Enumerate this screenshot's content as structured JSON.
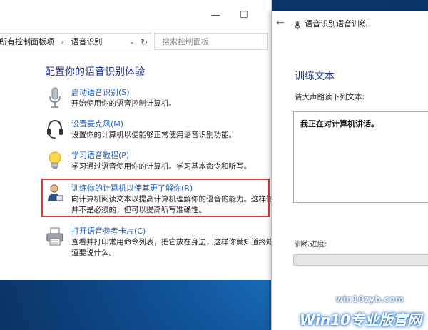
{
  "control_panel": {
    "breadcrumb": [
      "所有控制面板项",
      "语音识别"
    ],
    "search_placeholder": "搜索控制面板",
    "heading": "配置你的语音识别体验",
    "items": [
      {
        "title": "启动语音识别(S)",
        "desc": [
          "开始使用你的语音控制计算机。"
        ],
        "icon": "microphone-icon"
      },
      {
        "title": "设置麦克风(M)",
        "desc": [
          "设置你的计算机以便能够正常使用语音识别功能。"
        ],
        "icon": "headset-icon"
      },
      {
        "title": "学习语音教程(P)",
        "desc": [
          "学习通过语音使用你的计算机。学习基本命令和听写。"
        ],
        "icon": "lightbulb-icon"
      },
      {
        "title": "训练你的计算机以使其更了解你(R)",
        "desc": [
          "向计算机阅读文本以提高计算机理解你的语音的能力。这样做",
          "并不是必须的，但可以提高听写准确性。"
        ],
        "icon": "user-training-icon"
      },
      {
        "title": "打开语音参考卡片(C)",
        "desc": [
          "查看并打印常用命令列表，把它放在身边，这样你就知道终知",
          "道要说什么。"
        ],
        "icon": "printer-icon"
      }
    ]
  },
  "wizard": {
    "title": "语音识别语音训练",
    "heading": "训练文本",
    "prompt": "请大声朗读下列文本:",
    "read_text": "我正在对计算机讲话。",
    "progress_label": "训练进度:",
    "progress": 0
  },
  "watermark": {
    "url": "win10zyb.com",
    "brand": "Win10专业版官网"
  }
}
